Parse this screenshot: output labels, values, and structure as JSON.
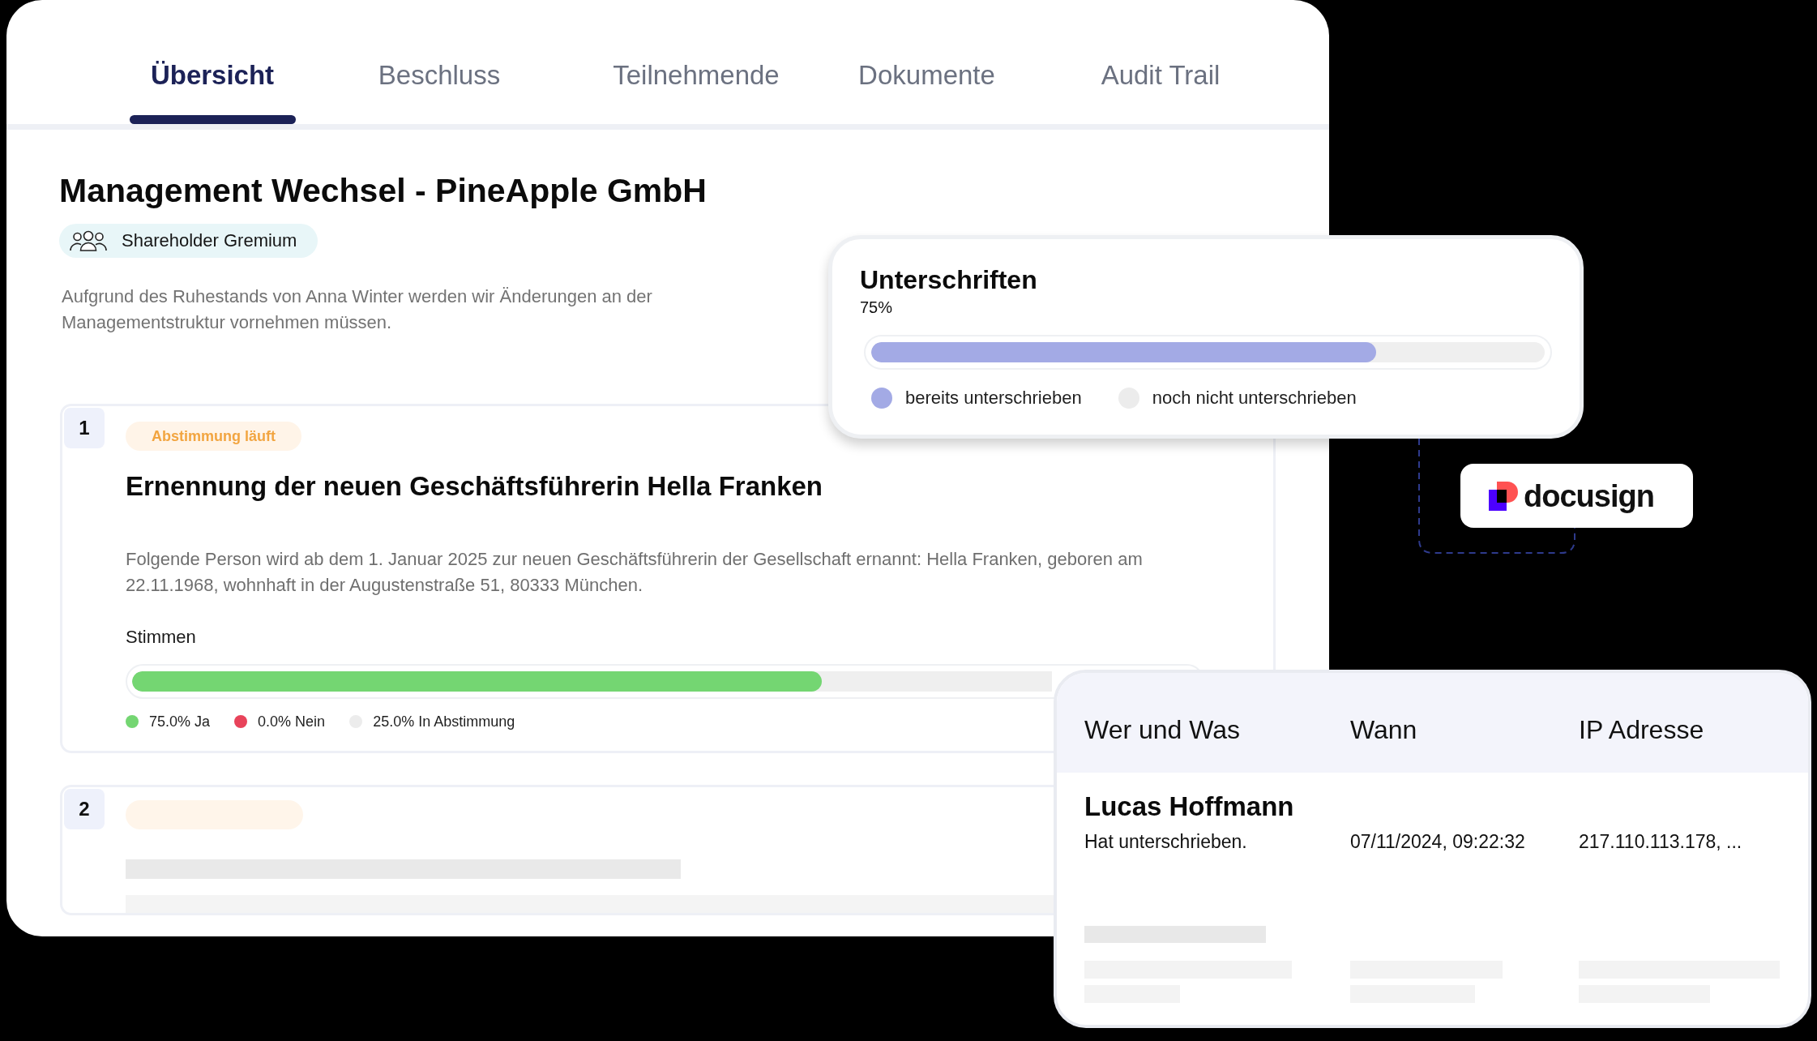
{
  "tabs": [
    {
      "label": "Übersicht",
      "selected": true
    },
    {
      "label": "Beschluss",
      "selected": false
    },
    {
      "label": "Teilnehmende",
      "selected": false
    },
    {
      "label": "Dokumente",
      "selected": false
    },
    {
      "label": "Audit Trail",
      "selected": false
    }
  ],
  "resolution": {
    "title": "Management Wechsel - PineApple GmbH",
    "committee": "Shareholder Gremium",
    "description": "Aufgrund des Ruhestands von Anna Winter werden wir Änderungen an der Managementstruktur vornehmen müssen.",
    "agenda_items": [
      {
        "kind": "full",
        "number": "1",
        "status": "Abstimmung läuft",
        "title": "Ernennung der neuen Geschäftsführerin Hella Franken",
        "description": "Folgende Person wird ab dem 1. Januar 2025 zur neuen Geschäftsführerin der Gesellschaft ernannt: Hella Franken, geboren am 22.11.1968, wohnhaft in der Augustenstraße 51, 80333 München.",
        "votes": {
          "label": "Stimmen",
          "level": 0.75,
          "legend": [
            {
              "label": "75.0% Ja",
              "color": "#74d672"
            },
            {
              "label": "0.0% Nein",
              "color": "#e8435a"
            },
            {
              "label": "25.0% In Abstimmung",
              "color": "#ececec"
            }
          ]
        }
      },
      {
        "kind": "loading",
        "number": "2"
      }
    ]
  },
  "signatures": {
    "title": "Unterschriften",
    "reading": "75%",
    "level": 0.75,
    "legend": [
      {
        "label": "bereits unterschrieben",
        "color": "#a3aae5"
      },
      {
        "label": "noch nicht unterschrieben",
        "color": "#ececec"
      }
    ]
  },
  "integration": {
    "logo_text": "docusign"
  },
  "audit_trail": {
    "columns": [
      "Wer und Was",
      "Wann",
      "IP Adresse"
    ],
    "rows": [
      {
        "kind": "entry",
        "name": "Lucas Hoffmann",
        "action": "Hat unterschrieben.",
        "time": "07/11/2024, 09:22:32",
        "ip": "217.110.113.178, ..."
      },
      {
        "kind": "loading"
      }
    ]
  }
}
